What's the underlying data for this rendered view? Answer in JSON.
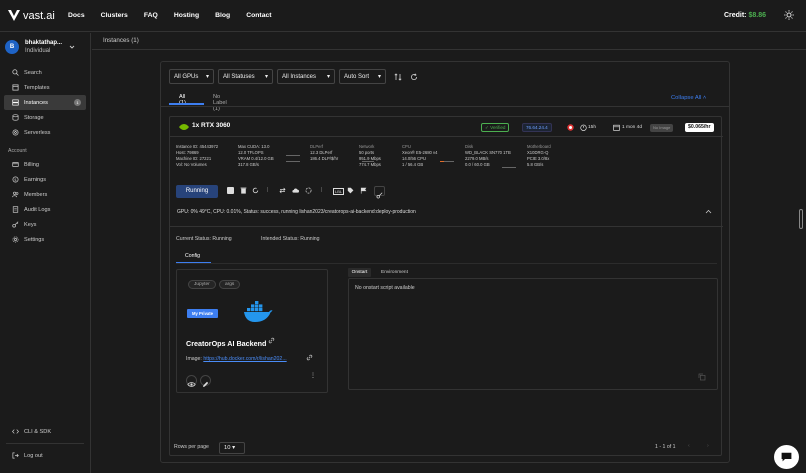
{
  "header": {
    "logo_text": "vast.ai",
    "nav": [
      "Docs",
      "Clusters",
      "FAQ",
      "Hosting",
      "Blog",
      "Contact"
    ],
    "credit_label": "Credit:",
    "credit_value": "$8.86"
  },
  "sidebar": {
    "user_initial": "B",
    "user_name": "bhaktathap...",
    "user_type": "Individual",
    "items": [
      {
        "label": "Search",
        "icon": "search-icon"
      },
      {
        "label": "Templates",
        "icon": "template-icon"
      },
      {
        "label": "Instances",
        "icon": "instances-icon",
        "badge": "1"
      },
      {
        "label": "Storage",
        "icon": "storage-icon"
      },
      {
        "label": "Serverless",
        "icon": "serverless-icon"
      }
    ],
    "account_label": "Account",
    "account_items": [
      {
        "label": "Billing",
        "icon": "billing-icon"
      },
      {
        "label": "Earnings",
        "icon": "earnings-icon"
      },
      {
        "label": "Members",
        "icon": "members-icon"
      },
      {
        "label": "Audit Logs",
        "icon": "audit-icon"
      },
      {
        "label": "Keys",
        "icon": "key-icon"
      },
      {
        "label": "Settings",
        "icon": "gear-icon"
      }
    ],
    "bottom_items": [
      {
        "label": "CLI & SDK",
        "icon": "code-icon"
      },
      {
        "label": "Log out",
        "icon": "logout-icon"
      }
    ]
  },
  "breadcrumb": "Instances (1)",
  "filters": {
    "gpus": "All GPUs",
    "statuses": "All Statuses",
    "instances": "All Instances",
    "sort": "Auto Sort"
  },
  "tabs": {
    "all": "All (1)",
    "no_label": "No Label (1)",
    "collapse": "Collapse All"
  },
  "instance": {
    "gpu": "1x RTX 3060",
    "verified": "Verified",
    "ip": "76.64.24.4",
    "uptime": "15h",
    "age": "1 mon 4d",
    "no_image": "No Image",
    "price": "$0.065/hr",
    "col1": [
      "Instance ID: 45443972",
      "Host: 79869",
      "Machine ID: 27221",
      "Vol: No Volumes"
    ],
    "col2": [
      "Max CUDA: 13.0",
      "12.0 TFLOPS",
      "VRAM 0.4/12.0 GB",
      "317.8 GB/s"
    ],
    "col3": [
      "DLPerf",
      "12.3 DLPerf",
      "186.4 DLP/$/hr"
    ],
    "col4": [
      "Network",
      "50 ports",
      "951.9 Mbps",
      "774.7 Mbps"
    ],
    "col5": [
      "CPU",
      "Xeon® E5-2680 v4",
      "14.0/56 CPU",
      "1 / 56.4 GB"
    ],
    "col6": [
      "Disk",
      "WD_BLACK SN770 1TB",
      "2279.0 MB/s",
      "0.0 / 60.0 GB"
    ],
    "col7": [
      "Motherboard",
      "X10DRG-Q",
      "PCIE 3.0/8x",
      "5.8 GB/s"
    ],
    "run_label": "Running",
    "status_line": "GPU: 0% 49°C, CPU: 0.01%, Status: success, running lishan2023/creatorops-ai-backend:deploy-production",
    "current_status": "Current Status: Running",
    "intended_status": "Intended Status: Running",
    "config_tab": "Config",
    "template": {
      "tags": [
        "Jupyter",
        "args"
      ],
      "private": "My Private",
      "name": "CreatorOps AI Backend",
      "image_label": "Image:",
      "image_link": "https://hub.docker.com/r/lishan202..."
    },
    "editor_tabs": [
      "Onstart",
      "Environment"
    ],
    "onstart_text": "No onstart script available"
  },
  "pagination": {
    "rows_label": "Rows per page",
    "rows_value": "10",
    "range": "1 - 1 of 1"
  },
  "colors": {
    "accent": "#3d7ef0",
    "credit": "#4caf50",
    "verified": "#4caf50"
  }
}
